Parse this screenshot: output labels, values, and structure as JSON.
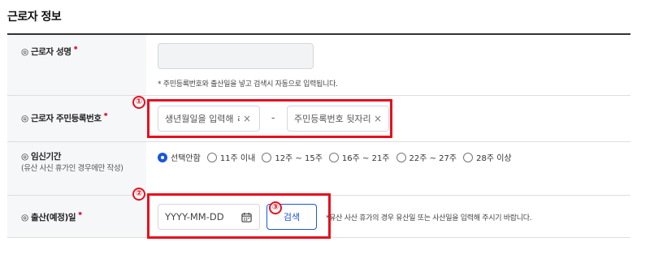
{
  "section": {
    "title": "근로자 정보"
  },
  "rows": {
    "name": {
      "label": "◎ 근로자 성명",
      "required_mark": "•",
      "input_value": "",
      "note": "* 주민등록번호와 출산일을 넣고 검색시 자동으로 입력됩니다."
    },
    "rrn": {
      "label": "◎ 근로자 주민등록번호",
      "required_mark": "•",
      "front_placeholder": "생년월일을 입력해 ㄹ",
      "back_placeholder": "주민등록번호 뒷자리",
      "dash": "-",
      "clear_icon": "×"
    },
    "pregnancy": {
      "label": "◎ 임신기간",
      "sublabel": "(유산 사신 휴가인 경우에만 작성)",
      "options": [
        "선택안함",
        "11주 이내",
        "12주 ~ 15주",
        "16주 ~ 21주",
        "22주 ~ 27주",
        "28주 이상"
      ],
      "selected_index": 0
    },
    "birth": {
      "label": "◎ 출산(예정)일",
      "required_mark": "•",
      "date_placeholder": "YYYY-MM-DD",
      "search_label": "검색",
      "note": "*유산 사산 휴가의 경우 유산일 또는 사산일을 입력해 주시기 바랍니다."
    }
  },
  "annotations": {
    "badge1": "①",
    "badge2": "②",
    "badge3": "③"
  },
  "colors": {
    "accent": "#1a56db",
    "required": "#e0263e",
    "highlight": "#e8101e"
  }
}
